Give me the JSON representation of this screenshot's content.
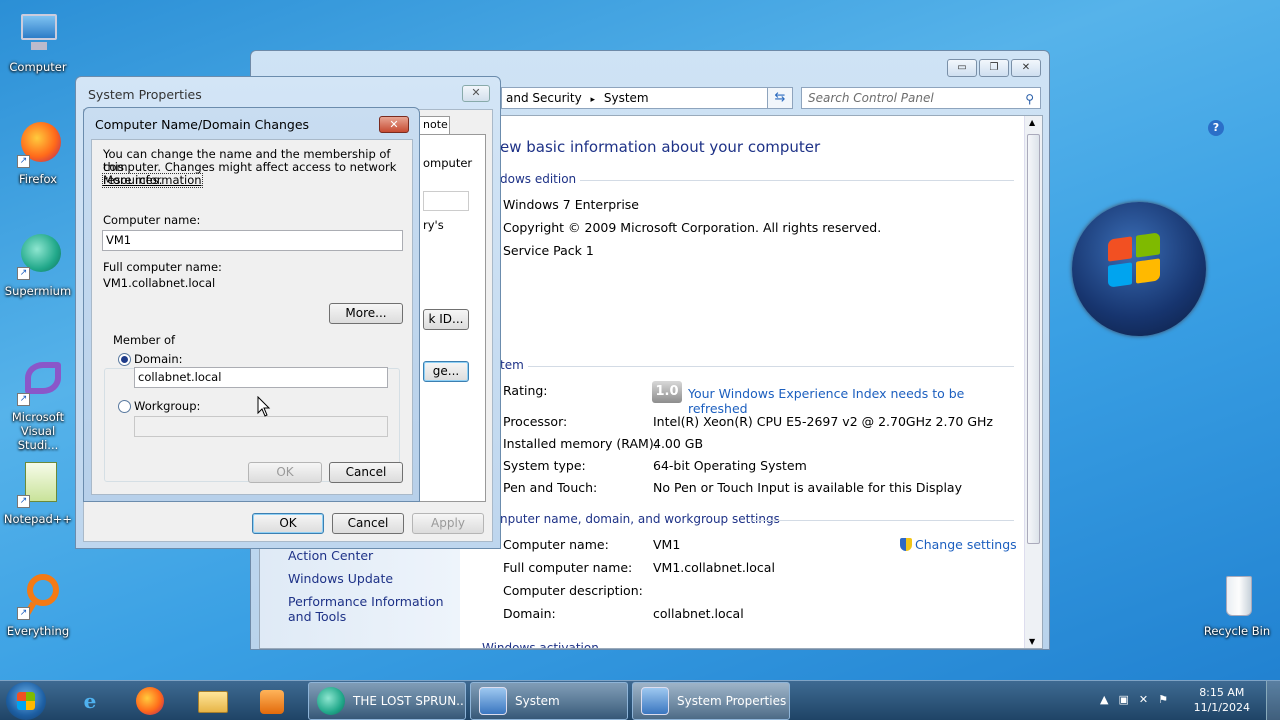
{
  "desktop": {
    "icons": [
      {
        "label": "Computer"
      },
      {
        "label": "Firefox"
      },
      {
        "label": "Supermium"
      },
      {
        "label": "Microsoft Visual Studi..."
      },
      {
        "label": "Notepad++"
      },
      {
        "label": "Everything"
      },
      {
        "label": "Recycle Bin"
      }
    ]
  },
  "control_panel": {
    "address": {
      "crumb_partial": "and Security",
      "crumb_sep": "▸",
      "crumb_current": "System"
    },
    "search_placeholder": "Search Control Panel",
    "heading": "ew basic information about your computer",
    "edition_section": "dows edition",
    "edition": [
      "Windows 7 Enterprise",
      "Copyright © 2009 Microsoft Corporation.  All rights reserved.",
      "Service Pack 1"
    ],
    "system_section": "tem",
    "rating_label": "Rating:",
    "rating_score": "1.0",
    "rating_link": "Your Windows Experience Index needs to be refreshed",
    "system_rows": [
      {
        "label": "Processor:",
        "value": "Intel(R) Xeon(R) CPU E5-2697 v2 @ 2.70GHz   2.70 GHz"
      },
      {
        "label": "Installed memory (RAM):",
        "value": "4.00 GB"
      },
      {
        "label": "System type:",
        "value": "64-bit Operating System"
      },
      {
        "label": "Pen and Touch:",
        "value": "No Pen or Touch Input is available for this Display"
      }
    ],
    "name_section": "nputer name, domain, and workgroup settings",
    "change_settings": "Change settings",
    "name_rows": [
      {
        "label": "Computer name:",
        "value": "VM1"
      },
      {
        "label": "Full computer name:",
        "value": "VM1.collabnet.local"
      },
      {
        "label": "Computer description:",
        "value": ""
      },
      {
        "label": "Domain:",
        "value": "collabnet.local"
      }
    ],
    "cut_section": "Windows activation",
    "left_links": [
      "Action Center",
      "Windows Update",
      "Performance Information and Tools"
    ]
  },
  "system_properties": {
    "title": "System Properties",
    "tab_partial": "note",
    "partial_texts": [
      "omputer",
      "ry's"
    ],
    "partial_buttons": [
      "k ID...",
      "ge..."
    ],
    "ok": "OK",
    "cancel": "Cancel",
    "apply": "Apply"
  },
  "domain_dialog": {
    "title": "Computer Name/Domain Changes",
    "intro_line1": "You can change the name and the membership of this",
    "intro_line2": "computer. Changes might affect access to network resources.",
    "more_info_link": "More information",
    "computer_name_label": "Computer name:",
    "computer_name_value": "VM1",
    "full_name_label": "Full computer name:",
    "full_name_value": "VM1.collabnet.local",
    "more_button": "More...",
    "member_of_label": "Member of",
    "domain_label": "Domain:",
    "domain_value": "collabnet.local",
    "workgroup_label": "Workgroup:",
    "workgroup_value": "",
    "ok": "OK",
    "cancel": "Cancel"
  },
  "taskbar": {
    "tasks": [
      {
        "label": "THE LOST SPRUN..."
      },
      {
        "label": "System"
      },
      {
        "label": "System Properties"
      }
    ],
    "time": "8:15 AM",
    "date": "11/1/2024"
  },
  "colors": {
    "link": "#1c5fbf",
    "heading": "#1e3287",
    "desktop": "#3aa0e4"
  }
}
